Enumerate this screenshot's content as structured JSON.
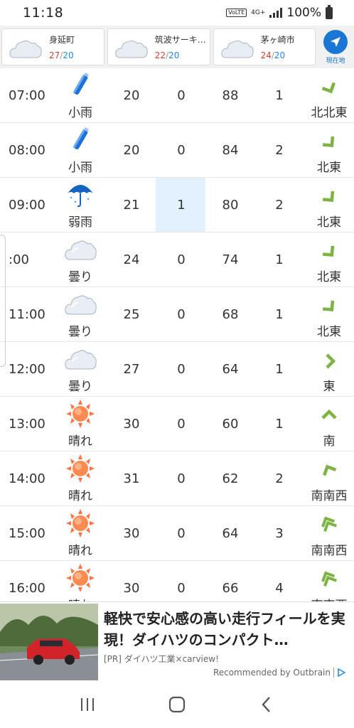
{
  "status": {
    "time": "11:18",
    "volte": "VoLTE",
    "network": "4G+",
    "battery": "100%"
  },
  "locations": [
    {
      "name": "身延町",
      "high": "27",
      "low": "20",
      "icon": "cloudy-icon"
    },
    {
      "name": "筑波サーキ…",
      "high": "22",
      "low": "20",
      "icon": "cloudy-icon"
    },
    {
      "name": "茅ヶ崎市",
      "high": "24",
      "low": "20",
      "icon": "cloudy-icon"
    }
  ],
  "current_location_label": "現在地",
  "hourly": [
    {
      "time": "07:00",
      "weather": "小雨",
      "icon": "light-rain-icon",
      "temp": "20",
      "precip": "0",
      "humidity": "88",
      "wind": "1",
      "direction": "北北東",
      "dir_icon": "wind-arrow-icon"
    },
    {
      "time": "08:00",
      "weather": "小雨",
      "icon": "light-rain-icon",
      "temp": "20",
      "precip": "0",
      "humidity": "84",
      "wind": "2",
      "direction": "北東",
      "dir_icon": "wind-arrow-icon"
    },
    {
      "time": "09:00",
      "weather": "弱雨",
      "icon": "umbrella-icon",
      "temp": "21",
      "precip": "1",
      "humidity": "80",
      "wind": "2",
      "direction": "北東",
      "dir_icon": "wind-arrow-icon"
    },
    {
      "time": ":00",
      "weather": "曇り",
      "icon": "cloudy-icon",
      "temp": "24",
      "precip": "0",
      "humidity": "74",
      "wind": "1",
      "direction": "北東",
      "dir_icon": "wind-arrow-icon"
    },
    {
      "time": "11:00",
      "weather": "曇り",
      "icon": "cloudy-icon",
      "temp": "25",
      "precip": "0",
      "humidity": "68",
      "wind": "1",
      "direction": "北東",
      "dir_icon": "wind-arrow-icon"
    },
    {
      "time": "12:00",
      "weather": "曇り",
      "icon": "cloudy-icon",
      "temp": "27",
      "precip": "0",
      "humidity": "64",
      "wind": "1",
      "direction": "東",
      "dir_icon": "wind-arrow-icon"
    },
    {
      "time": "13:00",
      "weather": "晴れ",
      "icon": "sunny-icon",
      "temp": "30",
      "precip": "0",
      "humidity": "60",
      "wind": "1",
      "direction": "南",
      "dir_icon": "wind-arrow-icon"
    },
    {
      "time": "14:00",
      "weather": "晴れ",
      "icon": "sunny-icon",
      "temp": "31",
      "precip": "0",
      "humidity": "62",
      "wind": "2",
      "direction": "南南西",
      "dir_icon": "wind-arrow-icon"
    },
    {
      "time": "15:00",
      "weather": "晴れ",
      "icon": "sunny-icon",
      "temp": "30",
      "precip": "0",
      "humidity": "64",
      "wind": "3",
      "direction": "南南西",
      "dir_icon": "wind-double-arrow-icon"
    },
    {
      "time": "16:00",
      "weather": "晴れ",
      "icon": "sunny-icon",
      "temp": "30",
      "precip": "0",
      "humidity": "66",
      "wind": "4",
      "direction": "南南西",
      "dir_icon": "wind-double-arrow-icon"
    }
  ],
  "ad": {
    "headline": "軽快で安心感の高い走行フィールを実現！ダイハツのコンパクト…",
    "source": "[PR] ダイハツ工業×carview!",
    "recommended_by": "Recommended by Outbrain"
  },
  "colors": {
    "accent": "#1976d2",
    "high_temp": "#e53935",
    "low_temp": "#1e88e5",
    "wind_arrow": "#7cb342",
    "precip_highlight": "#e3f0fd"
  }
}
